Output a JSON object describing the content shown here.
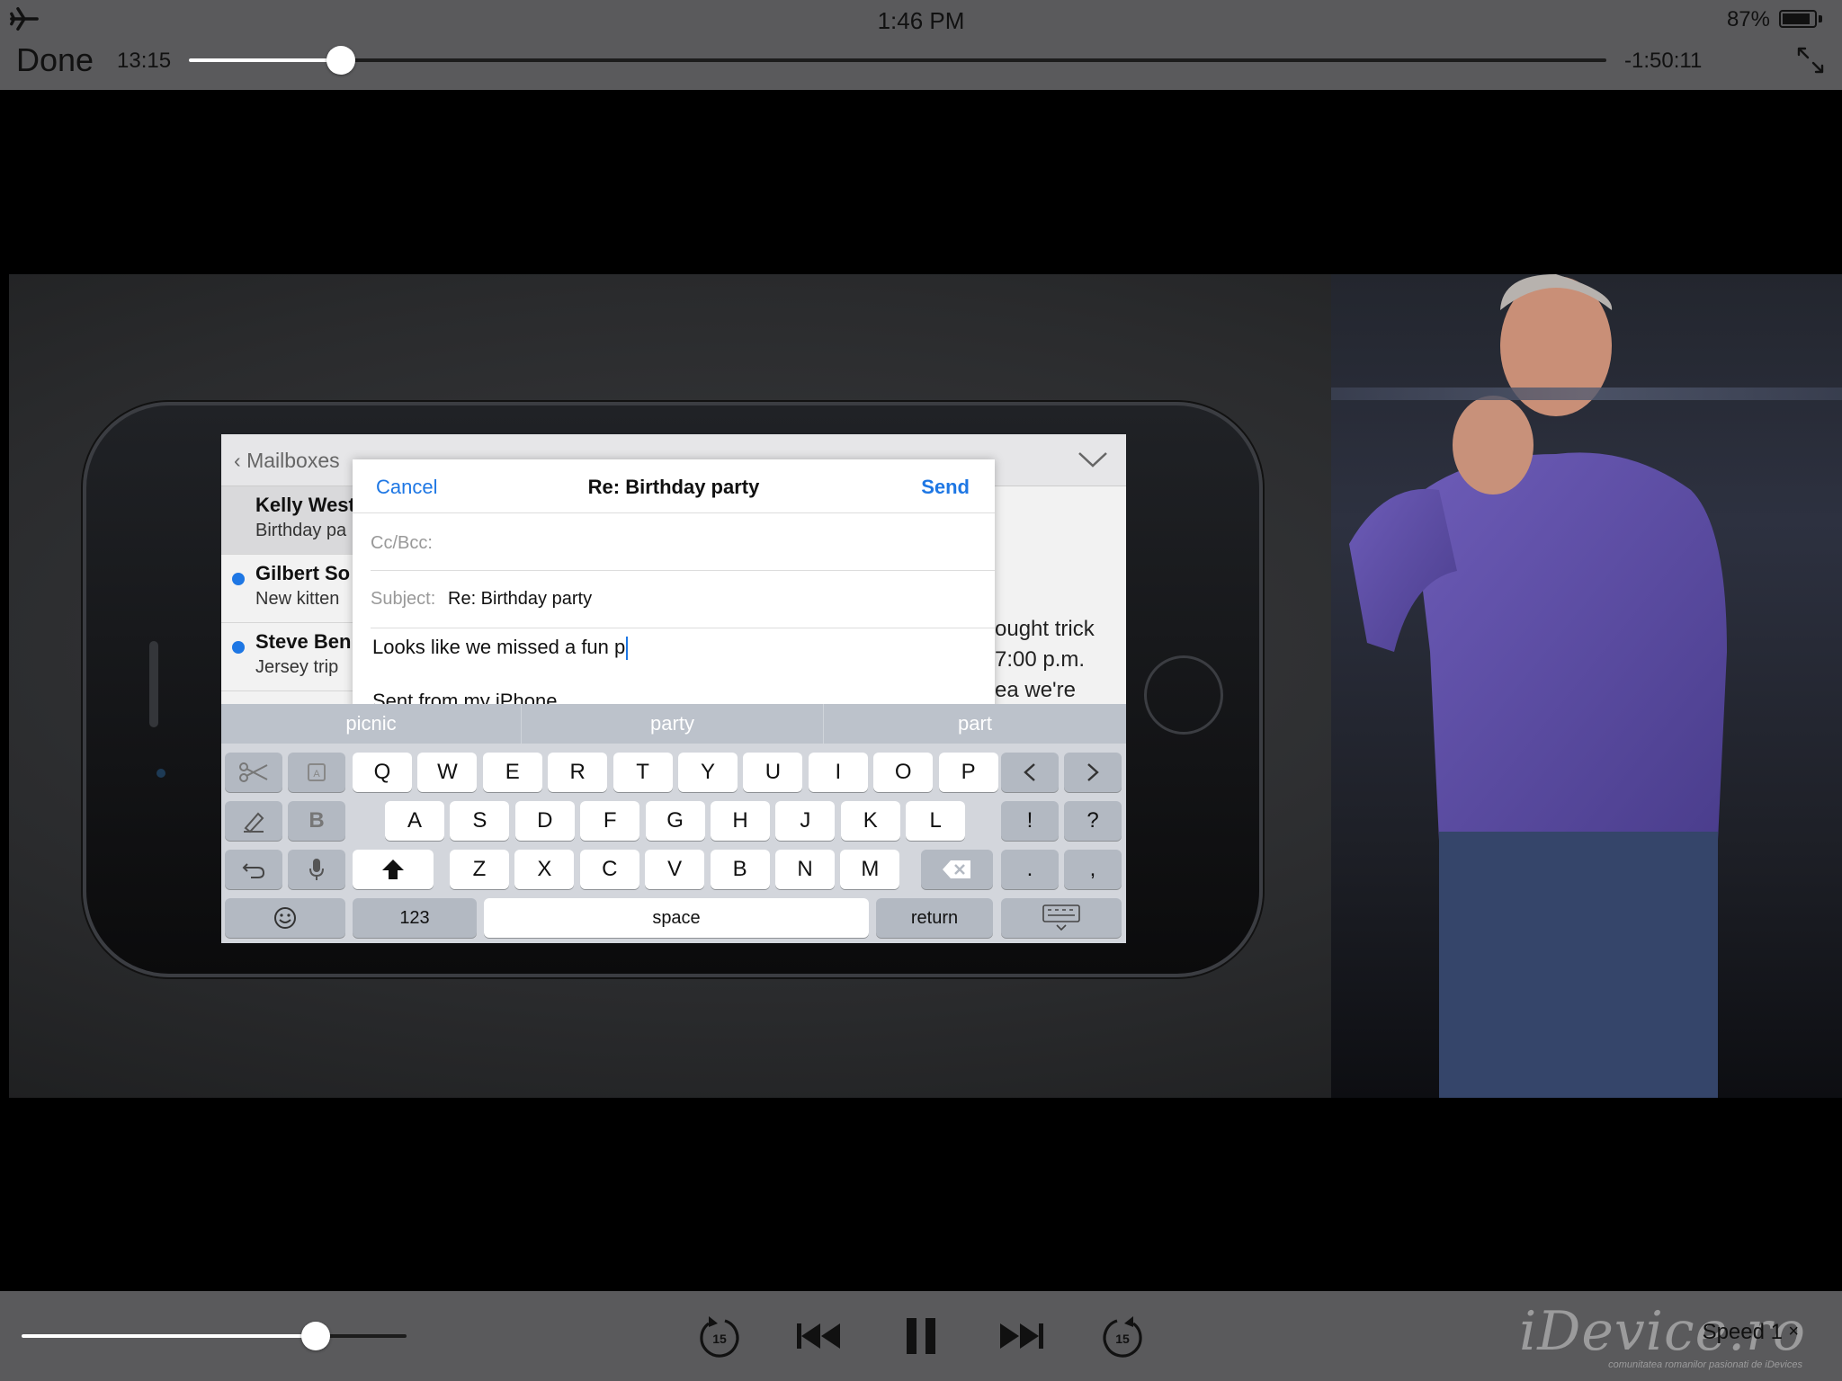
{
  "status_bar": {
    "time": "1:46 PM",
    "battery_percent": "87%",
    "battery_level": 0.87
  },
  "player": {
    "done_label": "Done",
    "elapsed": "13:15",
    "remaining": "-1:50:11",
    "progress": 0.1075,
    "volume": 0.765,
    "speed_label": "Speed 1",
    "speed_close": "×"
  },
  "video": {
    "mail": {
      "back_label": "Mailboxes",
      "rows": [
        {
          "from": "Kelly West",
          "subject": "Birthday pa",
          "unread": false
        },
        {
          "from": "Gilbert So",
          "subject": "New kitten",
          "unread": true
        },
        {
          "from": "Steve Ben",
          "subject": "Jersey trip",
          "unread": true
        }
      ],
      "preview_lines": [
        "ought trick",
        "7:00 p.m.",
        "ea we're"
      ]
    },
    "compose": {
      "cancel": "Cancel",
      "title": "Re: Birthday party",
      "send": "Send",
      "ccbcc_label": "Cc/Bcc:",
      "subject_label": "Subject:",
      "subject_value": "Re: Birthday party",
      "body": "Looks like we missed a fun p",
      "signature": "Sent from my iPhone"
    },
    "keyboard": {
      "suggestions": [
        "picnic",
        "party",
        "part"
      ],
      "row1": [
        "Q",
        "W",
        "E",
        "R",
        "T",
        "Y",
        "U",
        "I",
        "O",
        "P"
      ],
      "row2": [
        "A",
        "S",
        "D",
        "F",
        "G",
        "H",
        "J",
        "K",
        "L"
      ],
      "row3": [
        "Z",
        "X",
        "C",
        "V",
        "B",
        "N",
        "M"
      ],
      "bold_key": "B",
      "punct_row2": [
        "!",
        "?"
      ],
      "punct_row3": [
        ".",
        ","
      ],
      "numbers_key": "123",
      "space_key": "space",
      "return_key": "return"
    }
  },
  "watermark": {
    "brand": "iDevice.ro",
    "tagline": "comunitatea romanilor pasionati de iDevices"
  },
  "colors": {
    "accent": "#1e77e4",
    "bar": "#5a5a5c"
  }
}
